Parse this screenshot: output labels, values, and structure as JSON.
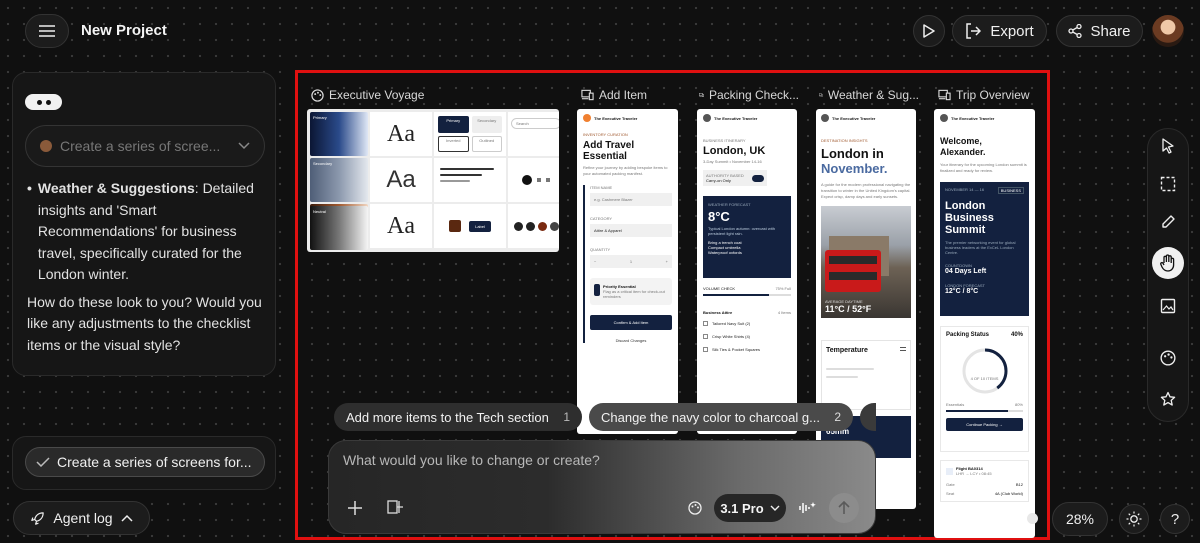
{
  "header": {
    "project_title": "New Project",
    "export_label": "Export",
    "share_label": "Share"
  },
  "sidebar": {
    "prompt_placeholder": "Create a series of scree...",
    "message": {
      "bullet_title": "Weather & Suggestions",
      "bullet_text": ": Detailed insights and 'Smart Recommendations' for business travel, specifically curated for the London winter.",
      "question": "How do these look to you? Would you like any adjustments to the checklist items or the visual style?"
    },
    "status_label": "Create a series of screens for...",
    "agent_log_label": "Agent log"
  },
  "frames": {
    "labels": [
      "Executive Voyage",
      "Add Item",
      "Packing Check...",
      "Weather & Sug...",
      "Trip Overview"
    ],
    "design_system": {
      "palette_names": [
        "Primary",
        "Secondary",
        "Tertiary",
        "Neutral"
      ],
      "sample": "Aa",
      "buttons": [
        "Primary",
        "Secondary",
        "Inverted",
        "Outlined"
      ],
      "search": "Search",
      "label_btn": "Label"
    },
    "brand": "The Executive Traveler",
    "add_item": {
      "kicker": "INVENTORY CURATION",
      "title": "Add Travel Essential",
      "desc": "Refine your journey by adding bespoke items to your automated packing manifest.",
      "item_label": "ITEM NAME",
      "item_placeholder": "e.g. Cashmere Blazer",
      "category_label": "CATEGORY",
      "category_value": "Attire & Apparel",
      "quantity_label": "QUANTITY",
      "qty_minus": "−",
      "quantity_value": "1",
      "qty_plus": "+",
      "priority_title": "Priority Essential",
      "priority_desc": "Flag as a critical item for check-out reminders",
      "confirm": "Confirm & Add Item",
      "discard": "Discard Changes"
    },
    "packing": {
      "kicker": "BUSINESS ITINERARY",
      "title": "London, UK",
      "subtitle": "3-Day Summit • November 14-16",
      "toggle_label": "AUTHORITY BASED",
      "toggle_value": "Carry-on Only",
      "weather_label": "WEATHER FORECAST",
      "temp": "8°C",
      "weather_desc": "Typical London autumn: overcast with persistent light rain.",
      "tips": [
        "Bring a trench coat",
        "Compact umbrella",
        "Waterproof oxfords"
      ],
      "volume_label": "VOLUME CHECK",
      "volume_value": "75% Full",
      "section": "Business Attire",
      "section_count": "4 Items",
      "items": [
        "Tailored Navy Suit (2)",
        "Crisp White Shirts (4)",
        "Silk Ties & Pocket Squares"
      ]
    },
    "weather": {
      "kicker": "DESTINATION INSIGHTS",
      "title_a": "London in",
      "title_b": "November.",
      "desc": "A guide for the modern professional navigating the transition to winter in the United Kingdom's capital. Expect crisp, damp days and early sunsets.",
      "photo_label": "AVERAGE DAYTIME",
      "photo_temp": "11°C / 52°F",
      "temp_title": "Temperature",
      "rain": "65mm"
    },
    "trip": {
      "title": "Welcome, Alexander.",
      "desc": "Your itinerary for the upcoming London summit is finalized and ready for review.",
      "dates": "NOVEMBER 14 — 16",
      "tag": "BUSINESS",
      "event": "London Business Summit",
      "event_desc": "The premier networking event for global business leaders at the ExCeL London Centre.",
      "countdown_label": "COUNTDOWN",
      "countdown": "04 Days Left",
      "forecast_label": "LONDON FORECAST",
      "forecast": "12°C / 8°C",
      "packing_status": "Packing Status",
      "packing_pct": "40%",
      "ring_label": "4 OF 10 ITEMS",
      "essentials": "Essentials",
      "essentials_pct": "80%",
      "continue": "Continue Packing →",
      "flight": "Flight BA0314",
      "flight_meta": "LHR → LCY • 08:45",
      "gate": "Gate",
      "gate_val": "B12",
      "seat": "Seat",
      "seat_val": "4A (Club World)"
    }
  },
  "suggestions": [
    {
      "text": "Add more items to the Tech section",
      "num": "1"
    },
    {
      "text": "Change the navy color to charcoal g...",
      "num": "2"
    }
  ],
  "composer": {
    "placeholder": "What would you like to change or create?",
    "model": "3.1 Pro"
  },
  "zoom": "28%",
  "volume_fill": 0.75,
  "packing_fill": 0.4,
  "essentials_fill": 0.8,
  "colors": {
    "highlight_border": "#e01010",
    "navy": "#13213f",
    "accent_blue": "#2f5fb0"
  },
  "icons": [
    "menu-icon",
    "play-icon",
    "export-icon",
    "share-icon",
    "pointer-icon",
    "select-icon",
    "pen-icon",
    "hand-icon",
    "image-icon",
    "palette-icon",
    "star-icon",
    "sun-icon",
    "help-icon"
  ]
}
